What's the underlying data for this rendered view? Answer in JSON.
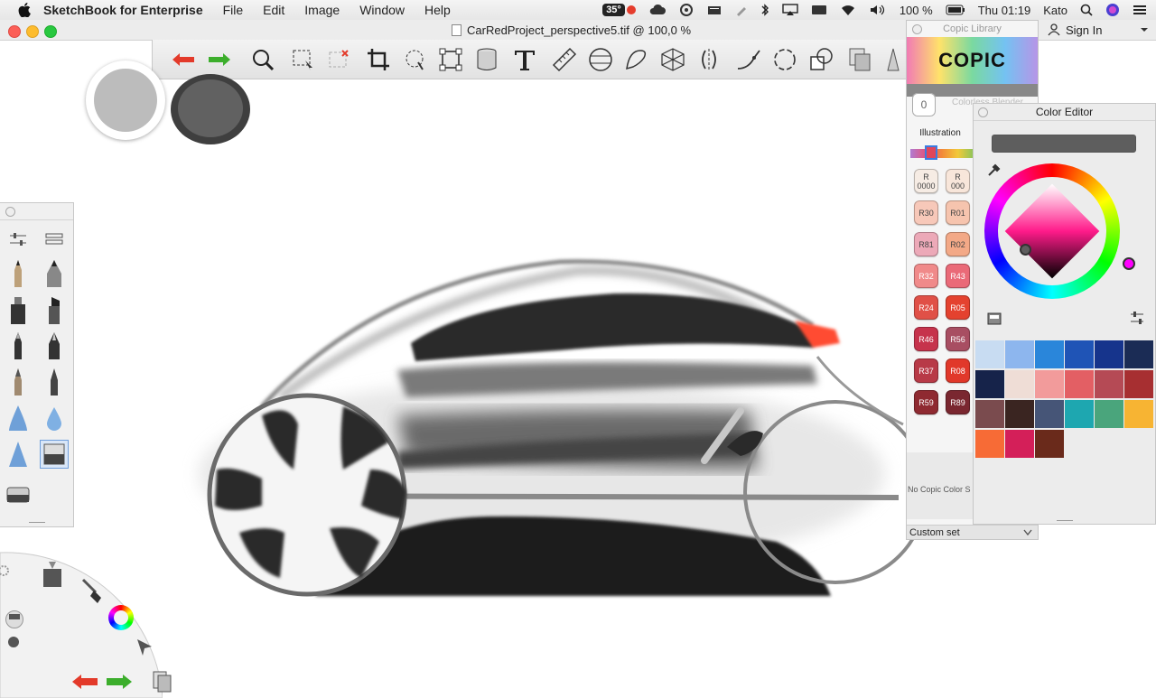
{
  "menubar": {
    "app_name": "SketchBook for Enterprise",
    "menus": [
      "File",
      "Edit",
      "Image",
      "Window",
      "Help"
    ],
    "temperature": "35°",
    "battery": "100 %",
    "clock": "Thu 01:19",
    "user": "Kato"
  },
  "window": {
    "title": "CarRedProject_perspective5.tif @ 100,0 %",
    "sign_in": "Sign In"
  },
  "colors": {
    "primary": "#bcbcbc",
    "secondary": "#616161",
    "selected_red": "#e0465a"
  },
  "toolbar": {
    "tools": [
      "undo-icon",
      "redo-icon",
      "magnifier-icon",
      "select-icon",
      "clear-selection-icon",
      "crop-icon",
      "lasso-icon",
      "transform-icon",
      "bucket-icon",
      "text-icon",
      "ruler-icon",
      "ellipse-guide-icon",
      "french-curve-icon",
      "perspective-icon",
      "symmetry-icon",
      "steady-stroke-icon",
      "predictive-stroke-icon",
      "layers-icon",
      "copic-icon"
    ]
  },
  "copic_library": {
    "title": "Copic Library",
    "logo": "COPIC",
    "colorless_value": "0",
    "colorless_label": "Colorless Blender",
    "set_name": "Illustration",
    "status": "No Copic Color S",
    "footer": "Custom set",
    "swatches": [
      {
        "label": "R\n0000",
        "color": "#f6ece4"
      },
      {
        "label": "R\n000",
        "color": "#f8e6da"
      },
      {
        "label": "R30",
        "color": "#f7c8b9"
      },
      {
        "label": "R01",
        "color": "#f6c4ae"
      },
      {
        "label": "R81",
        "color": "#eca9b8"
      },
      {
        "label": "R02",
        "color": "#f3a987"
      },
      {
        "label": "R32",
        "color": "#f08a8a"
      },
      {
        "label": "R43",
        "color": "#ea6a78"
      },
      {
        "label": "R24",
        "color": "#e05047"
      },
      {
        "label": "R05",
        "color": "#e4422f"
      },
      {
        "label": "R46",
        "color": "#c6334c"
      },
      {
        "label": "R56",
        "color": "#a84e62"
      },
      {
        "label": "R37",
        "color": "#b83a47"
      },
      {
        "label": "R08",
        "color": "#e1382a"
      },
      {
        "label": "R59",
        "color": "#8f2a31"
      },
      {
        "label": "R89",
        "color": "#7a2730"
      }
    ]
  },
  "color_editor": {
    "title": "Color Editor",
    "current_color": "#5e5e5e",
    "palette": [
      "#c8dcf2",
      "#8db6ee",
      "#2a86da",
      "#1f54b6",
      "#16348c",
      "#1b2c55",
      "#16234a",
      "#efddd6",
      "#f29b9b",
      "#e35f64",
      "#b54a55",
      "#a72f31",
      "#7a4b4e",
      "#3a2521",
      "#465577",
      "#1ea7b0",
      "#4aa57c",
      "#f7b433",
      "#f76b36",
      "#d41f59",
      "#6a2a1b"
    ]
  }
}
